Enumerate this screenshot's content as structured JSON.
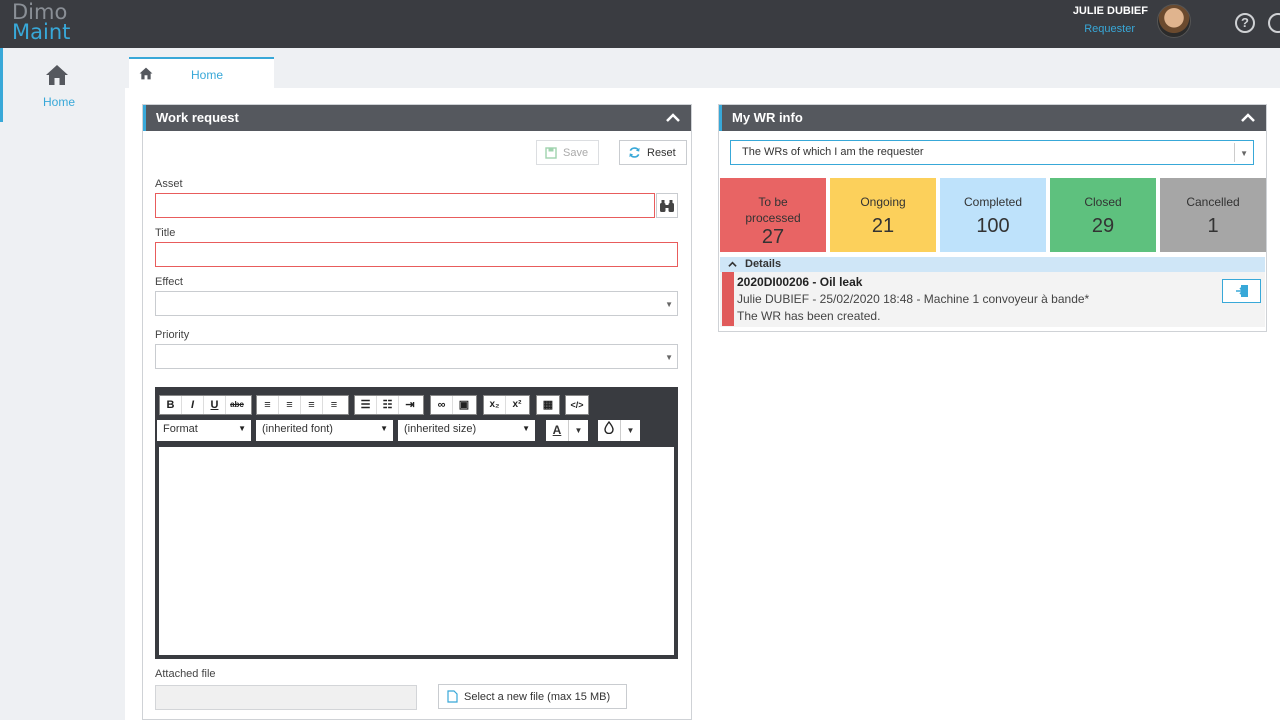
{
  "app": {
    "logo_line1": "Dimo",
    "logo_line2": "Maint",
    "user_name": "JULIE DUBIEF",
    "user_role": "Requester",
    "help_symbol": "?"
  },
  "sidebar": {
    "items": [
      {
        "label": "Home",
        "icon": "home-icon",
        "active": true
      }
    ]
  },
  "tabs": [
    {
      "label": "Home",
      "icon": "home-icon",
      "active": true
    }
  ],
  "work_request": {
    "title": "Work request",
    "save_label": "Save",
    "reset_label": "Reset",
    "fields": {
      "asset_label": "Asset",
      "asset_value": "",
      "title_label": "Title",
      "title_value": "",
      "effect_label": "Effect",
      "effect_value": "",
      "priority_label": "Priority",
      "priority_value": ""
    },
    "editor": {
      "format_label": "Format",
      "font_label": "(inherited font)",
      "size_label": "(inherited size)",
      "bold": "B",
      "italic": "I",
      "underline": "U",
      "strike": "abc",
      "text_color_glyph": "A",
      "content": ""
    },
    "attached_file_label": "Attached file",
    "select_file_label": "Select a new file (max 15 MB)"
  },
  "my_wr_info": {
    "title": "My WR info",
    "filter_value": "The WRs of which I am the requester",
    "status_tiles": [
      {
        "label": "To be processed",
        "count": "27",
        "color": "#e86464"
      },
      {
        "label": "Ongoing",
        "count": "21",
        "color": "#fcd05b"
      },
      {
        "label": "Completed",
        "count": "100",
        "color": "#bee2fb"
      },
      {
        "label": "Closed",
        "count": "29",
        "color": "#5ec17e"
      },
      {
        "label": "Cancelled",
        "count": "1",
        "color": "#a6a6a6"
      }
    ],
    "details_label": "Details",
    "items": [
      {
        "reference": "2020DI00206 - Oil leak",
        "meta": "Julie DUBIEF - 25/02/2020 18:48 - Machine 1 convoyeur à bande*",
        "status": "The WR has been created.",
        "stripe_color": "#e05a5a"
      }
    ]
  }
}
